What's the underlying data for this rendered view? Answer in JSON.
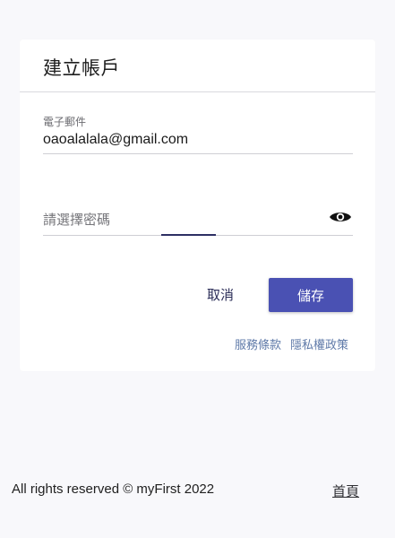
{
  "card": {
    "title": "建立帳戶",
    "email": {
      "label": "電子郵件",
      "value": "oaoalalala@gmail.com"
    },
    "password": {
      "placeholder": "請選擇密碼",
      "toggle_icon": "eye-icon"
    },
    "actions": {
      "cancel_label": "取消",
      "save_label": "儲存"
    },
    "links": {
      "terms": "服務條款",
      "privacy": "隱私權政策"
    }
  },
  "footer": {
    "copyright": "All rights reserved © myFirst 2022",
    "home_link": "首頁"
  },
  "colors": {
    "primary": "#4a51b3",
    "link": "#5e79a8",
    "background": "#f8f8fb"
  }
}
